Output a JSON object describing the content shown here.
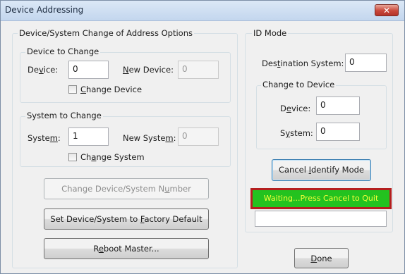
{
  "window": {
    "title": "Device Addressing",
    "close_glyph": "✕"
  },
  "options_group": {
    "title": "Device/System Change of Address Options",
    "device_group": {
      "title": "Device to Change",
      "device_label": {
        "pre": "De",
        "u": "v",
        "post": "ice:"
      },
      "device_value": "0",
      "new_device_label": {
        "pre": "",
        "u": "N",
        "post": "ew Device:"
      },
      "new_device_value": "0",
      "checkbox_label": {
        "pre": "",
        "u": "C",
        "post": "hange Device"
      }
    },
    "system_group": {
      "title": "System to Change",
      "system_label": {
        "pre": "Syste",
        "u": "m",
        "post": ":"
      },
      "system_value": "1",
      "new_system_label": {
        "pre": "New Syste",
        "u": "m",
        "post": ":"
      },
      "new_system_value": "0",
      "checkbox_label": {
        "pre": "Ch",
        "u": "a",
        "post": "nge System"
      }
    },
    "change_number_button": {
      "pre": "Change Device/System N",
      "u": "u",
      "post": "mber"
    },
    "factory_default_button": {
      "pre": "Set Device/System to ",
      "u": "F",
      "post": "actory Default"
    },
    "reboot_button": {
      "pre": "R",
      "u": "e",
      "post": "boot Master..."
    }
  },
  "id_mode": {
    "title": "ID Mode",
    "destination_label": {
      "pre": "Des",
      "u": "t",
      "post": "ination System:"
    },
    "destination_value": "0",
    "change_group": {
      "title": "Change to Device",
      "device_label": {
        "pre": "D",
        "u": "e",
        "post": "vice:"
      },
      "device_value": "0",
      "system_label": {
        "pre": "S",
        "u": "y",
        "post": "stem:"
      },
      "system_value": "0"
    },
    "cancel_button": {
      "pre": "Cancel ",
      "u": "I",
      "post": "dentify Mode"
    },
    "status_text": "Waiting...Press Cancel to Quit",
    "extra_field_value": ""
  },
  "done_button": {
    "pre": "",
    "u": "D",
    "post": "one"
  },
  "colors": {
    "status_bg": "#23c21f",
    "status_text": "#f6ff3a",
    "status_border": "#b41f1f",
    "close_red": "#c9473a"
  }
}
